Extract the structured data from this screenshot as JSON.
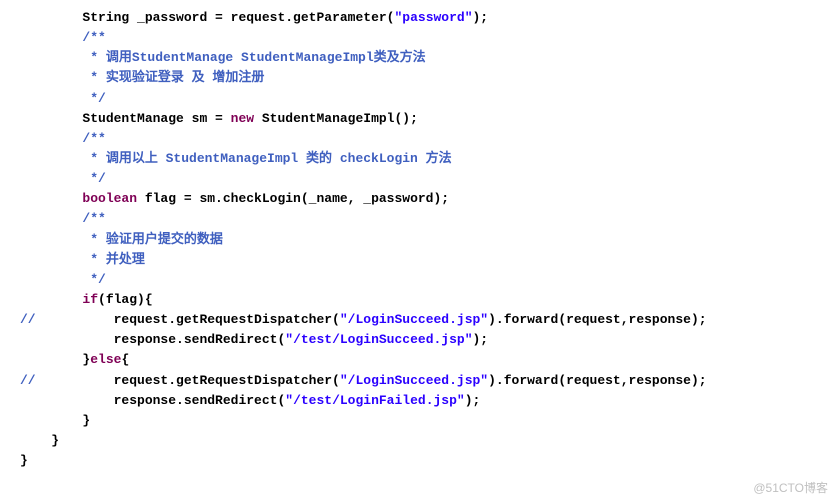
{
  "code": {
    "l1": {
      "indent": "        ",
      "p1": "String _password = request.getParameter(",
      "s1": "\"password\"",
      "p2": ");"
    },
    "l2": "        /**",
    "l3": "         * 调用StudentManage StudentManageImpl类及方法",
    "l4": "         * 实现验证登录 及 增加注册",
    "l5": "         */",
    "l6": {
      "indent": "        ",
      "p1": "StudentManage sm = ",
      "kw": "new",
      "p2": " StudentManageImpl();"
    },
    "l7": "        /**",
    "l8": "         * 调用以上 StudentManageImpl 类的 checkLogin 方法",
    "l9": "         */",
    "l10": {
      "indent": "        ",
      "kw": "boolean",
      "p1": " flag = sm.checkLogin(_name, _password);"
    },
    "l11": "        /**",
    "l12": "         * 验证用户提交的数据",
    "l13": "         * 并处理",
    "l14": "         */",
    "l15": {
      "indent": "        ",
      "kw": "if",
      "p1": "(flag){"
    },
    "l16": {
      "cmt": "//          ",
      "p1": "request.getRequestDispatcher(",
      "s1": "\"/LoginSucceed.jsp\"",
      "p2": ").forward(request,response);"
    },
    "l17": {
      "indent": "            ",
      "p1": "response.sendRedirect(",
      "s1": "\"/test/LoginSucceed.jsp\"",
      "p2": ");"
    },
    "l18": {
      "indent": "        }",
      "kw": "else",
      "p1": "{"
    },
    "l19": {
      "cmt": "//          ",
      "p1": "request.getRequestDispatcher(",
      "s1": "\"/LoginSucceed.jsp\"",
      "p2": ").forward(request,response);"
    },
    "l20": {
      "indent": "            ",
      "p1": "response.sendRedirect(",
      "s1": "\"/test/LoginFailed.jsp\"",
      "p2": ");"
    },
    "l21": "        }",
    "l22": "    }",
    "l23": "",
    "l24": "",
    "l25": "}"
  },
  "watermark": "@51CTO博客"
}
